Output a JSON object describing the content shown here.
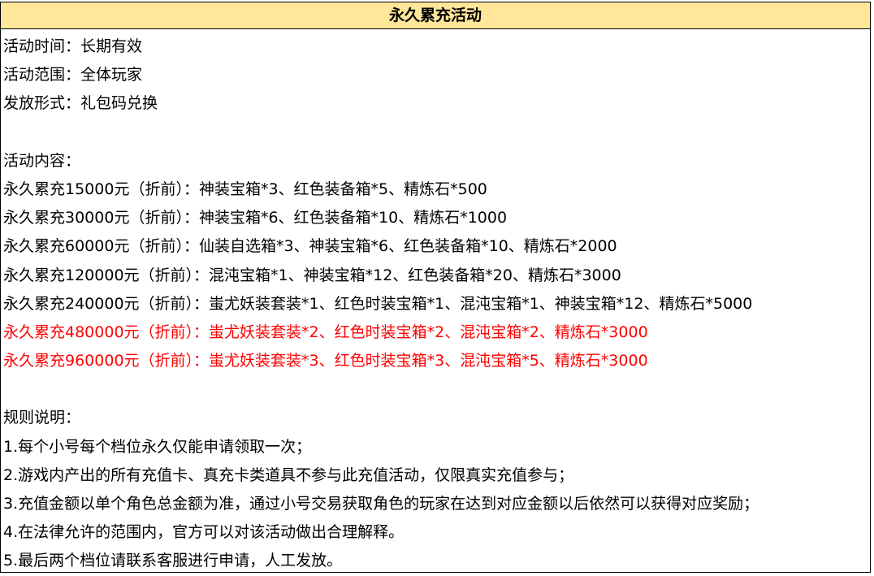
{
  "title": "永久累充活动",
  "header_bg": "#ffe699",
  "highlight_color": "#ff0000",
  "info": {
    "time": "活动时间：长期有效",
    "scope": "活动范围：全体玩家",
    "method": "发放形式：礼包码兑换"
  },
  "content_heading": "活动内容：",
  "tiers": [
    {
      "text": "永久累充15000元（折前）：神装宝箱*3、红色装备箱*5、精炼石*500",
      "highlight": false
    },
    {
      "text": "永久累充30000元（折前）：神装宝箱*6、红色装备箱*10、精炼石*1000",
      "highlight": false
    },
    {
      "text": "永久累充60000元（折前）：仙装自选箱*3、神装宝箱*6、红色装备箱*10、精炼石*2000",
      "highlight": false
    },
    {
      "text": "永久累充120000元（折前）：混沌宝箱*1、神装宝箱*12、红色装备箱*20、精炼石*3000",
      "highlight": false
    },
    {
      "text": "永久累充240000元（折前）：蚩尤妖装套装*1、红色时装宝箱*1、混沌宝箱*1、神装宝箱*12、精炼石*5000",
      "highlight": false
    },
    {
      "text": "永久累充480000元（折前）：蚩尤妖装套装*2、红色时装宝箱*2、混沌宝箱*2、精炼石*3000",
      "highlight": true
    },
    {
      "text": "永久累充960000元（折前）：蚩尤妖装套装*3、红色时装宝箱*3、混沌宝箱*5、精炼石*3000",
      "highlight": true
    }
  ],
  "rules_heading": "规则说明：",
  "rules": [
    "1.每个小号每个档位永久仅能申请领取一次；",
    "2.游戏内产出的所有充值卡、真充卡类道具不参与此充值活动，仅限真实充值参与；",
    "3.充值金额以单个角色总金额为准，通过小号交易获取角色的玩家在达到对应金额以后依然可以获得对应奖励；",
    "4.在法律允许的范围内，官方可以对该活动做出合理解释。",
    "5.最后两个档位请联系客服进行申请，人工发放。"
  ]
}
